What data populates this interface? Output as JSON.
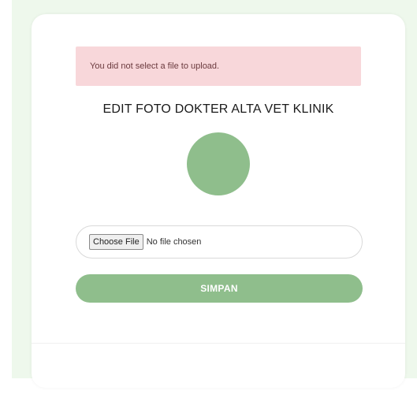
{
  "alert": {
    "message": "You did not select a file to upload."
  },
  "form": {
    "title": "EDIT FOTO DOKTER ALTA VET KLINIK",
    "file_button_label": "Choose File",
    "file_status": "No file chosen",
    "submit_label": "SIMPAN"
  },
  "colors": {
    "accent": "#8fbe8c",
    "alert_bg": "#f8d7da",
    "page_bg": "#eef8ec"
  }
}
